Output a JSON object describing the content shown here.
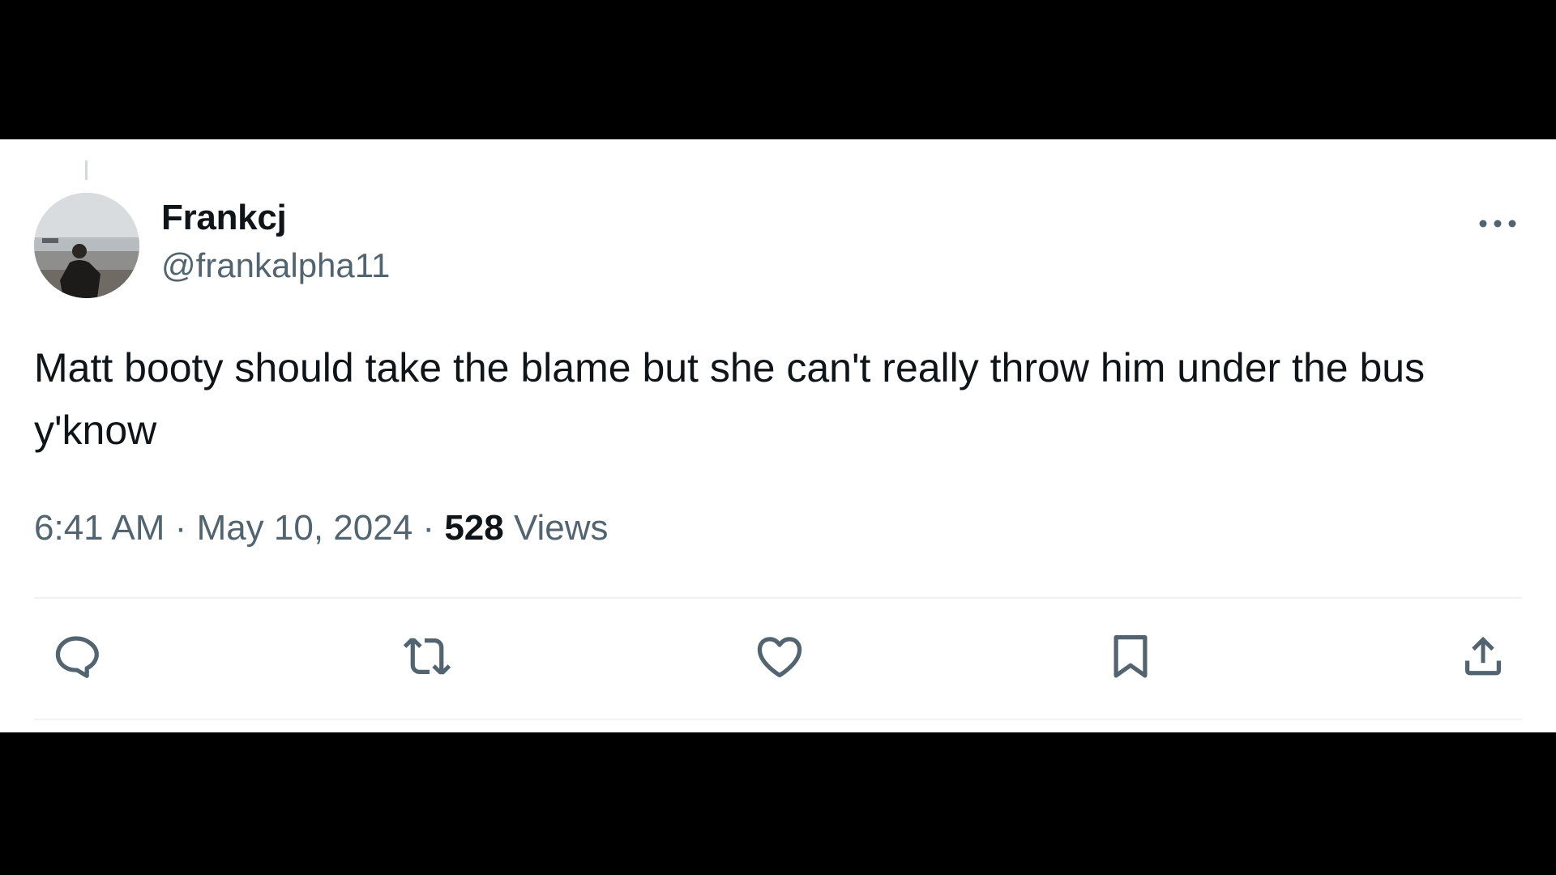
{
  "post": {
    "author": {
      "display_name": "Frankcj",
      "handle": "@frankalpha11"
    },
    "text": "Matt booty should take the blame but she can't really throw him under the bus y'know",
    "time": "6:41 AM",
    "separator": "·",
    "date": "May 10, 2024",
    "views_count": "528",
    "views_label": "Views"
  },
  "actions": {
    "reply_icon": "reply-icon",
    "repost_icon": "repost-icon",
    "like_icon": "heart-icon",
    "bookmark_icon": "bookmark-icon",
    "share_icon": "share-icon",
    "more_icon": "more-horizontal-icon"
  },
  "colors": {
    "text_primary": "#0f1419",
    "text_secondary": "#536471",
    "divider": "#eff3f4",
    "letterbox": "#000000"
  }
}
